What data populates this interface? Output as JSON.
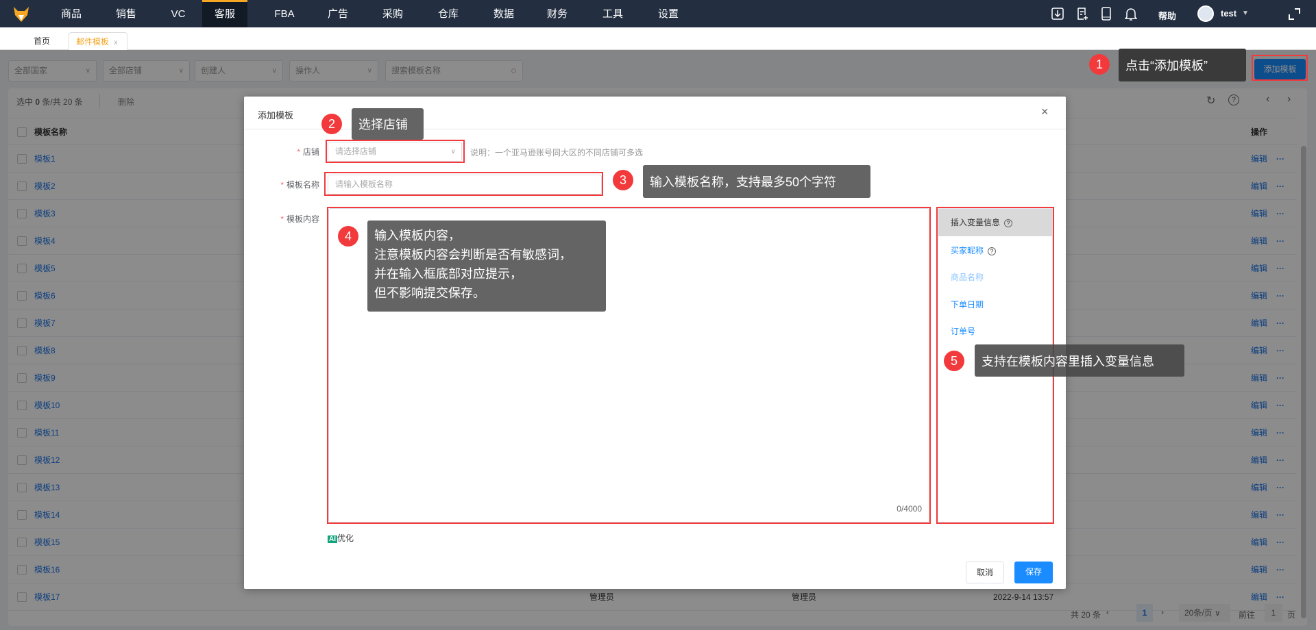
{
  "nav": {
    "items": [
      "商品",
      "销售",
      "VC",
      "客服",
      "FBA",
      "广告",
      "采购",
      "仓库",
      "数据",
      "财务",
      "工具",
      "设置"
    ],
    "active": "客服",
    "help": "帮助",
    "user": "test"
  },
  "tabs": {
    "home": "首页",
    "current": "邮件模板",
    "close": "x"
  },
  "filters": {
    "country": "全部国家",
    "shop": "全部店铺",
    "creator": "创建人",
    "operator": "操作人",
    "search_placeholder": "搜索模板名称"
  },
  "add_button": "添加模板",
  "table": {
    "selection": {
      "prefix": "选中",
      "count": "0",
      "suffix": "条/共 20 条"
    },
    "delete": "删除",
    "headers": {
      "name": "模板名称",
      "actions": "操作"
    },
    "edit": "编辑",
    "more": "···",
    "rows": [
      {
        "name": "模板1"
      },
      {
        "name": "模板2"
      },
      {
        "name": "模板3"
      },
      {
        "name": "模板4"
      },
      {
        "name": "模板5"
      },
      {
        "name": "模板6"
      },
      {
        "name": "模板7"
      },
      {
        "name": "模板8"
      },
      {
        "name": "模板9"
      },
      {
        "name": "模板10"
      },
      {
        "name": "模板11"
      },
      {
        "name": "模板12"
      },
      {
        "name": "模板13"
      },
      {
        "name": "模板14"
      },
      {
        "name": "模板15"
      },
      {
        "name": "模板16"
      },
      {
        "name": "模板17",
        "creator": "管理员",
        "operator": "管理员",
        "time": "2022-9-14 13:57"
      }
    ]
  },
  "pagination": {
    "total": "共 20 条",
    "page": "1",
    "page_size": "20条/页",
    "goto": "前往",
    "goto_value": "1",
    "page_unit": "页"
  },
  "modal": {
    "title": "添加模板",
    "shop_label": "店铺",
    "shop_placeholder": "请选择店铺",
    "shop_note": "说明：一个亚马逊账号同大区的不同店铺可多选",
    "name_label": "模板名称",
    "name_placeholder": "请输入模板名称",
    "content_label": "模板内容",
    "counter": "0/4000",
    "ai_badge": "AI",
    "ai_label": "优化",
    "variables_header": "插入变量信息",
    "variables": [
      "买家昵称",
      "商品名称",
      "下单日期",
      "订单号"
    ],
    "cancel": "取消",
    "save": "保存"
  },
  "annotations": [
    {
      "num": "1",
      "text": "点击“添加模板”"
    },
    {
      "num": "2",
      "text": "选择店铺"
    },
    {
      "num": "3",
      "text": "输入模板名称，支持最多50个字符"
    },
    {
      "num": "4",
      "lines": [
        "输入模板内容，",
        "注意模板内容会判断是否有敏感词，",
        "并在输入框底部对应提示，",
        "但不影响提交保存。"
      ]
    },
    {
      "num": "5",
      "text": "支持在模板内容里插入变量信息"
    }
  ],
  "colors": {
    "nav_bg": "#232f41",
    "accent": "#1a8cff",
    "annotation_red": "#f23a3c",
    "active_tab": "#f5a623"
  }
}
